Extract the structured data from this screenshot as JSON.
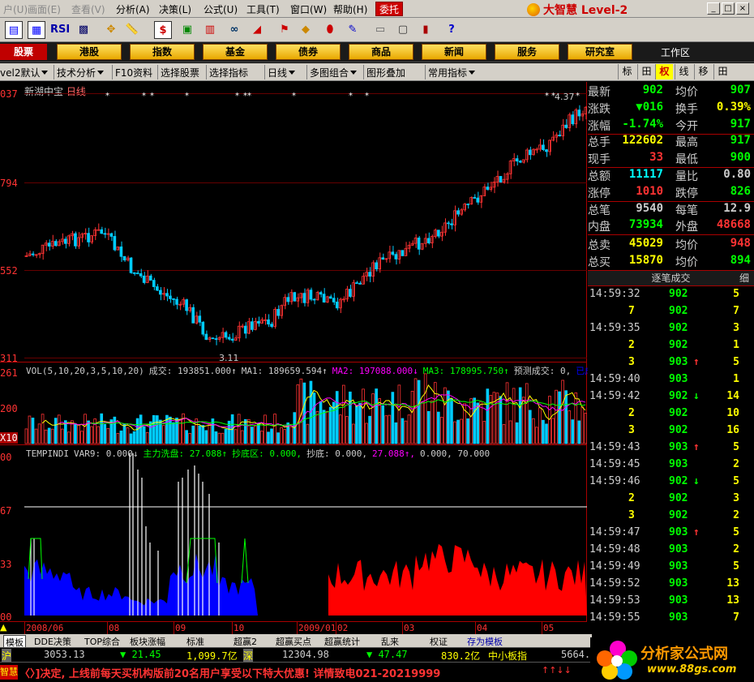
{
  "menubar": {
    "items": [
      {
        "label": "户(U)",
        "dim": true
      },
      {
        "label": "画面(E)",
        "dim": true
      },
      {
        "label": "查看(V)",
        "dim": true
      },
      {
        "label": "分析(A)",
        "dim": false
      },
      {
        "label": "决策(L)",
        "dim": false
      },
      {
        "label": "公式(U)",
        "dim": false
      },
      {
        "label": "工具(T)",
        "dim": false
      },
      {
        "label": "窗口(W)",
        "dim": false
      },
      {
        "label": "帮助(H)",
        "dim": false
      }
    ],
    "entrust": "委托",
    "brand": "大智慧 Level-2"
  },
  "toolbar": {
    "icons": [
      "window-icon",
      "chart-icon",
      "rsi-icon",
      "grid-icon",
      "move-icon",
      "ruler-icon",
      "dollar-icon",
      "ticker-icon",
      "bars-icon",
      "binoculars-icon",
      "signal-icon",
      "alert-icon",
      "diamond-icon",
      "marker-icon",
      "pen-icon",
      "notepad-icon",
      "screen-icon",
      "books-icon",
      "help-icon"
    ],
    "rsi_label": "RSI",
    "dollar_label": "$"
  },
  "navbar": {
    "active": "股票",
    "buttons": [
      "港股",
      "指数",
      "基金",
      "债券",
      "商品",
      "新闻",
      "服务",
      "研究室"
    ],
    "workarea": "工作区"
  },
  "subtoolbar": {
    "items": [
      "vel2默认",
      "技术分析",
      "F10资料",
      "选择股票",
      "选择指标",
      "日线",
      "多图组合",
      "图形叠加",
      "常用指标"
    ],
    "right_tabs": [
      "标",
      "田",
      "权",
      "线",
      "移",
      "田"
    ]
  },
  "main_chart": {
    "stock_name": "新湖中宝",
    "period": "日线",
    "y_labels": [
      "037",
      "794",
      "552",
      "311"
    ],
    "high_note": "4.37",
    "low_note": "3.11"
  },
  "volume": {
    "legend": [
      {
        "text": "VOL(5,10,20,3,5,10,20)",
        "color": "#ccc"
      },
      {
        "text": "成交: 193851.000↑",
        "color": "#ccc"
      },
      {
        "text": "MA1: 189659.594↑",
        "color": "#ccc"
      },
      {
        "text": "MA2: 197088.000↓",
        "color": "#f0f"
      },
      {
        "text": "MA3: 178995.750↑",
        "color": "#0f0"
      },
      {
        "text": "预测成交: 0,",
        "color": "#ccc"
      },
      {
        "text": "已成交",
        "color": "#00f"
      }
    ],
    "y_labels": [
      "261",
      "200",
      "X10"
    ]
  },
  "indicator": {
    "legend": [
      {
        "text": "TEMPINDI",
        "color": "#ccc"
      },
      {
        "text": "VAR9: 0.000↓",
        "color": "#ccc"
      },
      {
        "text": "主力洗盘: 27.088↑",
        "color": "#0f0"
      },
      {
        "text": "抄底区: 0.000,",
        "color": "#0f0"
      },
      {
        "text": "抄底: 0.000,",
        "color": "#ccc"
      },
      {
        "text": "27.088↑,",
        "color": "#f0f"
      },
      {
        "text": "0.000, 70.000",
        "color": "#ccc"
      }
    ],
    "y_labels": [
      "00",
      "67",
      "33",
      "00"
    ]
  },
  "date_axis": [
    "2008/06",
    "08",
    "09",
    "10",
    "2009/01",
    "02",
    "03",
    "04",
    "05"
  ],
  "bottom_tabs": [
    "模板",
    "DDE决策",
    "TOP综合",
    "板块涨幅",
    "标准",
    "超赢2",
    "超赢买点",
    "超赢统计",
    "乱来",
    "权证",
    "存为模板"
  ],
  "index_bar": [
    {
      "text": "沪",
      "color": "#ff0"
    },
    {
      "text": "3053.13",
      "color": "#ccc"
    },
    {
      "text": "▼ 21.45",
      "color": "#0f0"
    },
    {
      "text": "1,099.7亿",
      "color": "#ff0"
    },
    {
      "text": "深",
      "color": "#ff0"
    },
    {
      "text": "12304.98",
      "color": "#ccc"
    },
    {
      "text": "▼ 47.47",
      "color": "#0f0"
    },
    {
      "text": "830.2亿",
      "color": "#ff0"
    },
    {
      "text": "中小板指",
      "color": "#ff0"
    },
    {
      "text": "5664.",
      "color": "#ccc"
    }
  ],
  "marquee": {
    "lead": "智慧",
    "text": "〈〉]决定, 上线前每天买机构版前20名用户享受以下特大优惠! 详情致电021-20219999"
  },
  "quote": {
    "rows": [
      {
        "l1": "最新",
        "v1": "902",
        "c1": "#0f0",
        "l2": "均价",
        "v2": "907",
        "c2": "#0f0"
      },
      {
        "l1": "涨跌",
        "v1": "▼016",
        "c1": "#0f0",
        "l2": "换手",
        "v2": "0.39%",
        "c2": "#ff0"
      },
      {
        "l1": "涨幅",
        "v1": "-1.74%",
        "c1": "#0f0",
        "l2": "今开",
        "v2": "917",
        "c2": "#0f0"
      },
      {
        "l1": "总手",
        "v1": "122602",
        "c1": "#ff0",
        "l2": "最高",
        "v2": "917",
        "c2": "#0f0"
      },
      {
        "l1": "现手",
        "v1": "33",
        "c1": "#f33",
        "l2": "最低",
        "v2": "900",
        "c2": "#0f0"
      },
      {
        "l1": "总额",
        "v1": "11117",
        "c1": "#0ff",
        "l2": "量比",
        "v2": "0.80",
        "c2": "#ccc"
      },
      {
        "l1": "涨停",
        "v1": "1010",
        "c1": "#f33",
        "l2": "跌停",
        "v2": "826",
        "c2": "#0f0"
      },
      {
        "l1": "总笔",
        "v1": "9540",
        "c1": "#ccc",
        "l2": "每笔",
        "v2": "12.9",
        "c2": "#ccc"
      },
      {
        "l1": "内盘",
        "v1": "73934",
        "c1": "#0f0",
        "l2": "外盘",
        "v2": "48668",
        "c2": "#f33"
      },
      {
        "l1": "总卖",
        "v1": "45029",
        "c1": "#ff0",
        "l2": "均价",
        "v2": "948",
        "c2": "#f33"
      },
      {
        "l1": "总买",
        "v1": "15870",
        "c1": "#ff0",
        "l2": "均价",
        "v2": "894",
        "c2": "#0f0"
      }
    ],
    "tick_header": "逐笔成交",
    "tick_header_right": "细"
  },
  "ticks": [
    {
      "t": "14:59:32",
      "p": "902",
      "v": "5",
      "a": ""
    },
    {
      "t": "",
      "p": "902",
      "v": "7",
      "a": "",
      "lv": "7"
    },
    {
      "t": "14:59:35",
      "p": "902",
      "v": "3",
      "a": ""
    },
    {
      "t": "",
      "p": "902",
      "v": "1",
      "a": "",
      "lv": "2"
    },
    {
      "t": "",
      "p": "903",
      "v": "5",
      "a": "up",
      "lv": "3"
    },
    {
      "t": "14:59:40",
      "p": "903",
      "v": "1",
      "a": ""
    },
    {
      "t": "14:59:42",
      "p": "902",
      "v": "14",
      "a": "down"
    },
    {
      "t": "",
      "p": "902",
      "v": "10",
      "a": "",
      "lv": "2"
    },
    {
      "t": "",
      "p": "902",
      "v": "16",
      "a": "",
      "lv": "3"
    },
    {
      "t": "14:59:43",
      "p": "903",
      "v": "5",
      "a": "up"
    },
    {
      "t": "14:59:45",
      "p": "903",
      "v": "2",
      "a": ""
    },
    {
      "t": "14:59:46",
      "p": "902",
      "v": "5",
      "a": "down"
    },
    {
      "t": "",
      "p": "902",
      "v": "3",
      "a": "",
      "lv": "2"
    },
    {
      "t": "",
      "p": "902",
      "v": "2",
      "a": "",
      "lv": "3"
    },
    {
      "t": "14:59:47",
      "p": "903",
      "v": "5",
      "a": "up"
    },
    {
      "t": "14:59:48",
      "p": "903",
      "v": "2",
      "a": ""
    },
    {
      "t": "14:59:49",
      "p": "903",
      "v": "5",
      "a": ""
    },
    {
      "t": "14:59:52",
      "p": "903",
      "v": "13",
      "a": ""
    },
    {
      "t": "14:59:53",
      "p": "903",
      "v": "13",
      "a": ""
    },
    {
      "t": "14:59:55",
      "p": "903",
      "v": "7",
      "a": ""
    }
  ],
  "logo": {
    "cn": "分析家公式网",
    "url": "www.88gs.com"
  }
}
